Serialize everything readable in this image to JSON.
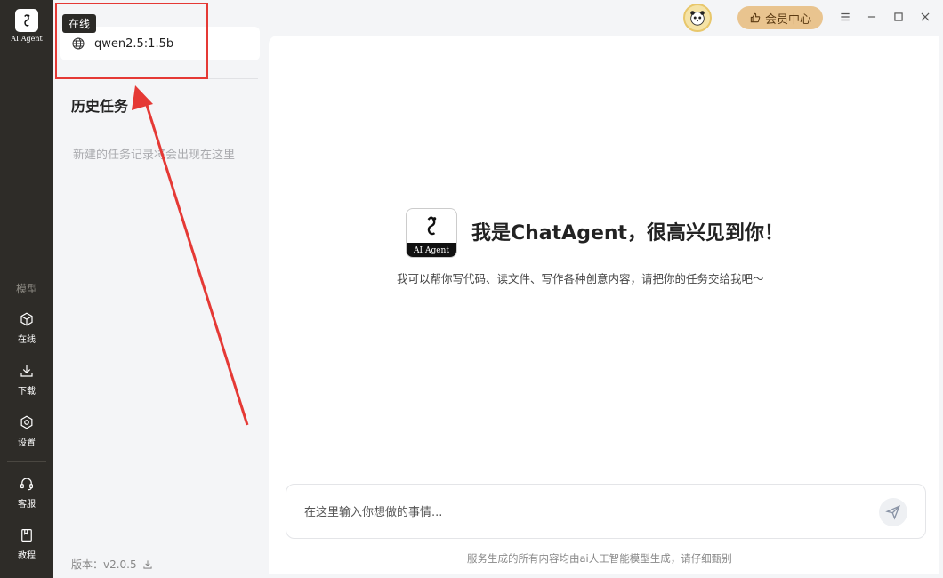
{
  "rail": {
    "logo_text": "AI Agent",
    "section_label": "模型",
    "items": [
      {
        "label": "在线",
        "icon": "cube-icon"
      },
      {
        "label": "下载",
        "icon": "download-icon"
      },
      {
        "label": "设置",
        "icon": "settings-icon"
      },
      {
        "label": "客服",
        "icon": "headset-icon"
      },
      {
        "label": "教程",
        "icon": "book-icon"
      }
    ]
  },
  "model_panel": {
    "online_badge": "在线",
    "model_name": "qwen2.5:1.5b",
    "history_title": "历史任务",
    "history_empty": "新建的任务记录将会出现在这里",
    "version": "版本：v2.0.5"
  },
  "titlebar": {
    "vip_label": "会员中心"
  },
  "welcome": {
    "logo_text": "AI Agent",
    "title": "我是ChatAgent，很高兴见到你！",
    "subtitle": "我可以帮你写代码、读文件、写作各种创意内容，请把你的任务交给我吧～"
  },
  "composer": {
    "placeholder": "在这里输入你想做的事情..."
  },
  "footer": {
    "disclaimer": "服务生成的所有内容均由ai人工智能模型生成，请仔细甄别"
  },
  "colors": {
    "rail_bg": "#2e2c28",
    "vip_bg": "#e9c48f",
    "annotation": "#e53935"
  }
}
